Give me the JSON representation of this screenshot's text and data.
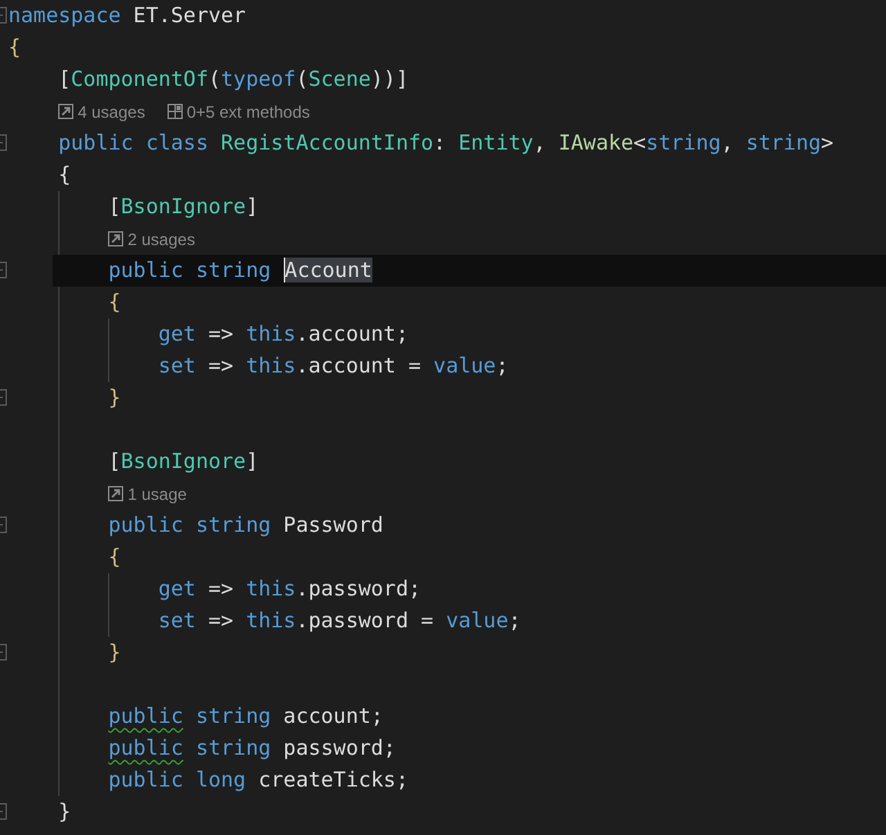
{
  "editor": {
    "lines": [
      {
        "kind": "code",
        "marker": true,
        "current": false,
        "tokens": [
          {
            "kind": "keyword",
            "text": "namespace"
          },
          {
            "kind": "plain",
            "text": " ET.Server"
          }
        ]
      },
      {
        "kind": "code",
        "marker": false,
        "current": false,
        "tokens": [
          {
            "kind": "brace",
            "text": "{"
          }
        ],
        "children": [
          {
            "kind": "code",
            "marker": false,
            "current": false,
            "tokens": [
              {
                "kind": "plain",
                "text": "["
              },
              {
                "kind": "type",
                "text": "ComponentOf"
              },
              {
                "kind": "plain",
                "text": "("
              },
              {
                "kind": "keyword",
                "text": "typeof"
              },
              {
                "kind": "plain",
                "text": "("
              },
              {
                "kind": "type",
                "text": "Scene"
              },
              {
                "kind": "plain",
                "text": "))]"
              }
            ]
          },
          {
            "kind": "lens",
            "items": [
              {
                "kind": "usages",
                "text": "4 usages"
              },
              {
                "kind": "ext_methods",
                "text": "0+5 ext methods"
              }
            ]
          },
          {
            "kind": "code",
            "marker": true,
            "current": false,
            "tokens": [
              {
                "kind": "keyword",
                "text": "public class "
              },
              {
                "kind": "type",
                "text": "RegistAccountInfo"
              },
              {
                "kind": "plain",
                "text": ": "
              },
              {
                "kind": "type",
                "text": "Entity"
              },
              {
                "kind": "plain",
                "text": ", "
              },
              {
                "kind": "interface",
                "text": "IAwake"
              },
              {
                "kind": "plain",
                "text": "<"
              },
              {
                "kind": "keyword",
                "text": "string"
              },
              {
                "kind": "plain",
                "text": ", "
              },
              {
                "kind": "keyword",
                "text": "string"
              },
              {
                "kind": "plain",
                "text": ">"
              }
            ]
          },
          {
            "kind": "code",
            "marker": false,
            "current": false,
            "tokens": [
              {
                "kind": "plain",
                "text": "{"
              }
            ],
            "children": [
              {
                "kind": "code",
                "marker": false,
                "current": false,
                "tokens": [
                  {
                    "kind": "plain",
                    "text": "["
                  },
                  {
                    "kind": "type",
                    "text": "BsonIgnore"
                  },
                  {
                    "kind": "plain",
                    "text": "]"
                  }
                ]
              },
              {
                "kind": "lens",
                "items": [
                  {
                    "kind": "usages",
                    "text": "2 usages"
                  }
                ]
              },
              {
                "kind": "code",
                "marker": true,
                "current": true,
                "tokens": [
                  {
                    "kind": "keyword",
                    "text": "public string "
                  },
                  {
                    "kind": "plain",
                    "text": "Account",
                    "selected": true
                  }
                ]
              },
              {
                "kind": "code",
                "marker": false,
                "current": false,
                "tokens": [
                  {
                    "kind": "brace",
                    "text": "{"
                  }
                ],
                "children": [
                  {
                    "kind": "code",
                    "marker": false,
                    "current": false,
                    "tokens": [
                      {
                        "kind": "keyword",
                        "text": "get"
                      },
                      {
                        "kind": "plain",
                        "text": " => "
                      },
                      {
                        "kind": "keyword",
                        "text": "this"
                      },
                      {
                        "kind": "plain",
                        "text": ".account;"
                      }
                    ]
                  },
                  {
                    "kind": "code",
                    "marker": false,
                    "current": false,
                    "tokens": [
                      {
                        "kind": "keyword",
                        "text": "set"
                      },
                      {
                        "kind": "plain",
                        "text": " => "
                      },
                      {
                        "kind": "keyword",
                        "text": "this"
                      },
                      {
                        "kind": "plain",
                        "text": ".account = "
                      },
                      {
                        "kind": "keyword",
                        "text": "value"
                      },
                      {
                        "kind": "plain",
                        "text": ";"
                      }
                    ]
                  }
                ]
              },
              {
                "kind": "code",
                "marker": true,
                "current": false,
                "tokens": [
                  {
                    "kind": "brace",
                    "text": "}"
                  }
                ]
              },
              {
                "kind": "blank"
              },
              {
                "kind": "code",
                "marker": false,
                "current": false,
                "tokens": [
                  {
                    "kind": "plain",
                    "text": "["
                  },
                  {
                    "kind": "type",
                    "text": "BsonIgnore"
                  },
                  {
                    "kind": "plain",
                    "text": "]"
                  }
                ]
              },
              {
                "kind": "lens",
                "items": [
                  {
                    "kind": "usages",
                    "text": "1 usage"
                  }
                ]
              },
              {
                "kind": "code",
                "marker": true,
                "current": false,
                "tokens": [
                  {
                    "kind": "keyword",
                    "text": "public string"
                  },
                  {
                    "kind": "plain",
                    "text": " Password"
                  }
                ]
              },
              {
                "kind": "code",
                "marker": false,
                "current": false,
                "tokens": [
                  {
                    "kind": "brace",
                    "text": "{"
                  }
                ],
                "children": [
                  {
                    "kind": "code",
                    "marker": false,
                    "current": false,
                    "tokens": [
                      {
                        "kind": "keyword",
                        "text": "get"
                      },
                      {
                        "kind": "plain",
                        "text": " => "
                      },
                      {
                        "kind": "keyword",
                        "text": "this"
                      },
                      {
                        "kind": "plain",
                        "text": ".password;"
                      }
                    ]
                  },
                  {
                    "kind": "code",
                    "marker": false,
                    "current": false,
                    "tokens": [
                      {
                        "kind": "keyword",
                        "text": "set"
                      },
                      {
                        "kind": "plain",
                        "text": " => "
                      },
                      {
                        "kind": "keyword",
                        "text": "this"
                      },
                      {
                        "kind": "plain",
                        "text": ".password = "
                      },
                      {
                        "kind": "keyword",
                        "text": "value"
                      },
                      {
                        "kind": "plain",
                        "text": ";"
                      }
                    ]
                  }
                ]
              },
              {
                "kind": "code",
                "marker": true,
                "current": false,
                "tokens": [
                  {
                    "kind": "brace",
                    "text": "}"
                  }
                ]
              },
              {
                "kind": "blank"
              },
              {
                "kind": "code",
                "marker": false,
                "current": false,
                "tokens": [
                  {
                    "kind": "keyword",
                    "text": "public",
                    "squiggle": true
                  },
                  {
                    "kind": "keyword",
                    "text": " string"
                  },
                  {
                    "kind": "plain",
                    "text": " account;"
                  }
                ]
              },
              {
                "kind": "code",
                "marker": false,
                "current": false,
                "tokens": [
                  {
                    "kind": "keyword",
                    "text": "public",
                    "squiggle": true
                  },
                  {
                    "kind": "keyword",
                    "text": " string"
                  },
                  {
                    "kind": "plain",
                    "text": " password;"
                  }
                ]
              },
              {
                "kind": "code",
                "marker": false,
                "current": false,
                "tokens": [
                  {
                    "kind": "keyword",
                    "text": "public long"
                  },
                  {
                    "kind": "plain",
                    "text": " createTicks;"
                  }
                ]
              }
            ]
          },
          {
            "kind": "code",
            "marker": true,
            "current": false,
            "tokens": [
              {
                "kind": "plain",
                "text": "}"
              }
            ]
          }
        ]
      }
    ]
  }
}
